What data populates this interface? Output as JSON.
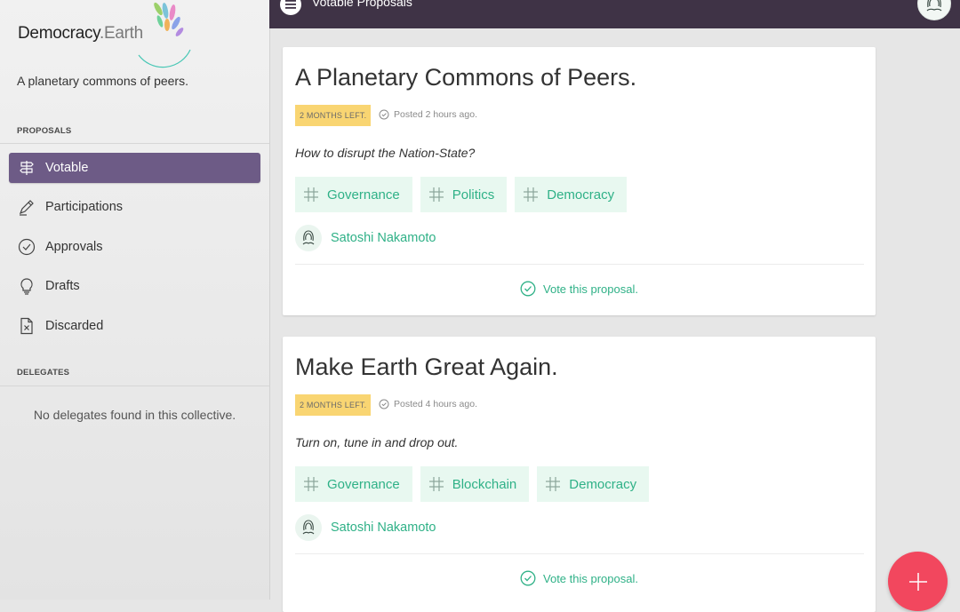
{
  "brand": {
    "name_part1": "Democracy",
    "name_part2": "Earth",
    "tagline": "A planetary commons of peers."
  },
  "sidebar": {
    "proposals_label": "PROPOSALS",
    "items": [
      {
        "label": "Votable",
        "icon": "signpost-icon",
        "active": true
      },
      {
        "label": "Participations",
        "icon": "pen-icon"
      },
      {
        "label": "Approvals",
        "icon": "check-circle-icon"
      },
      {
        "label": "Drafts",
        "icon": "lightbulb-icon"
      },
      {
        "label": "Discarded",
        "icon": "file-x-icon"
      }
    ],
    "delegates_label": "DELEGATES",
    "delegates_empty": "No delegates found in this collective."
  },
  "header": {
    "title": "Votable Proposals",
    "menu_icon": "menu-icon"
  },
  "proposals": [
    {
      "title": "A Planetary Commons of Peers.",
      "badge": "2 MONTHS LEFT.",
      "posted": "Posted 2 hours ago.",
      "description": "How to disrupt the Nation-State?",
      "tags": [
        "Governance",
        "Politics",
        "Democracy"
      ],
      "author": "Satoshi Nakamoto",
      "vote_label": "Vote this proposal."
    },
    {
      "title": "Make Earth Great Again.",
      "badge": "2 MONTHS LEFT.",
      "posted": "Posted 4 hours ago.",
      "description": "Turn on, tune in and drop out.",
      "tags": [
        "Governance",
        "Blockchain",
        "Democracy"
      ],
      "author": "Satoshi Nakamoto",
      "vote_label": "Vote this proposal."
    }
  ],
  "colors": {
    "accent_green": "#2fb187",
    "sidebar_active": "#6d5b86",
    "topbar": "#3f3346",
    "badge": "#f9d572",
    "fab": "#f2475e"
  }
}
